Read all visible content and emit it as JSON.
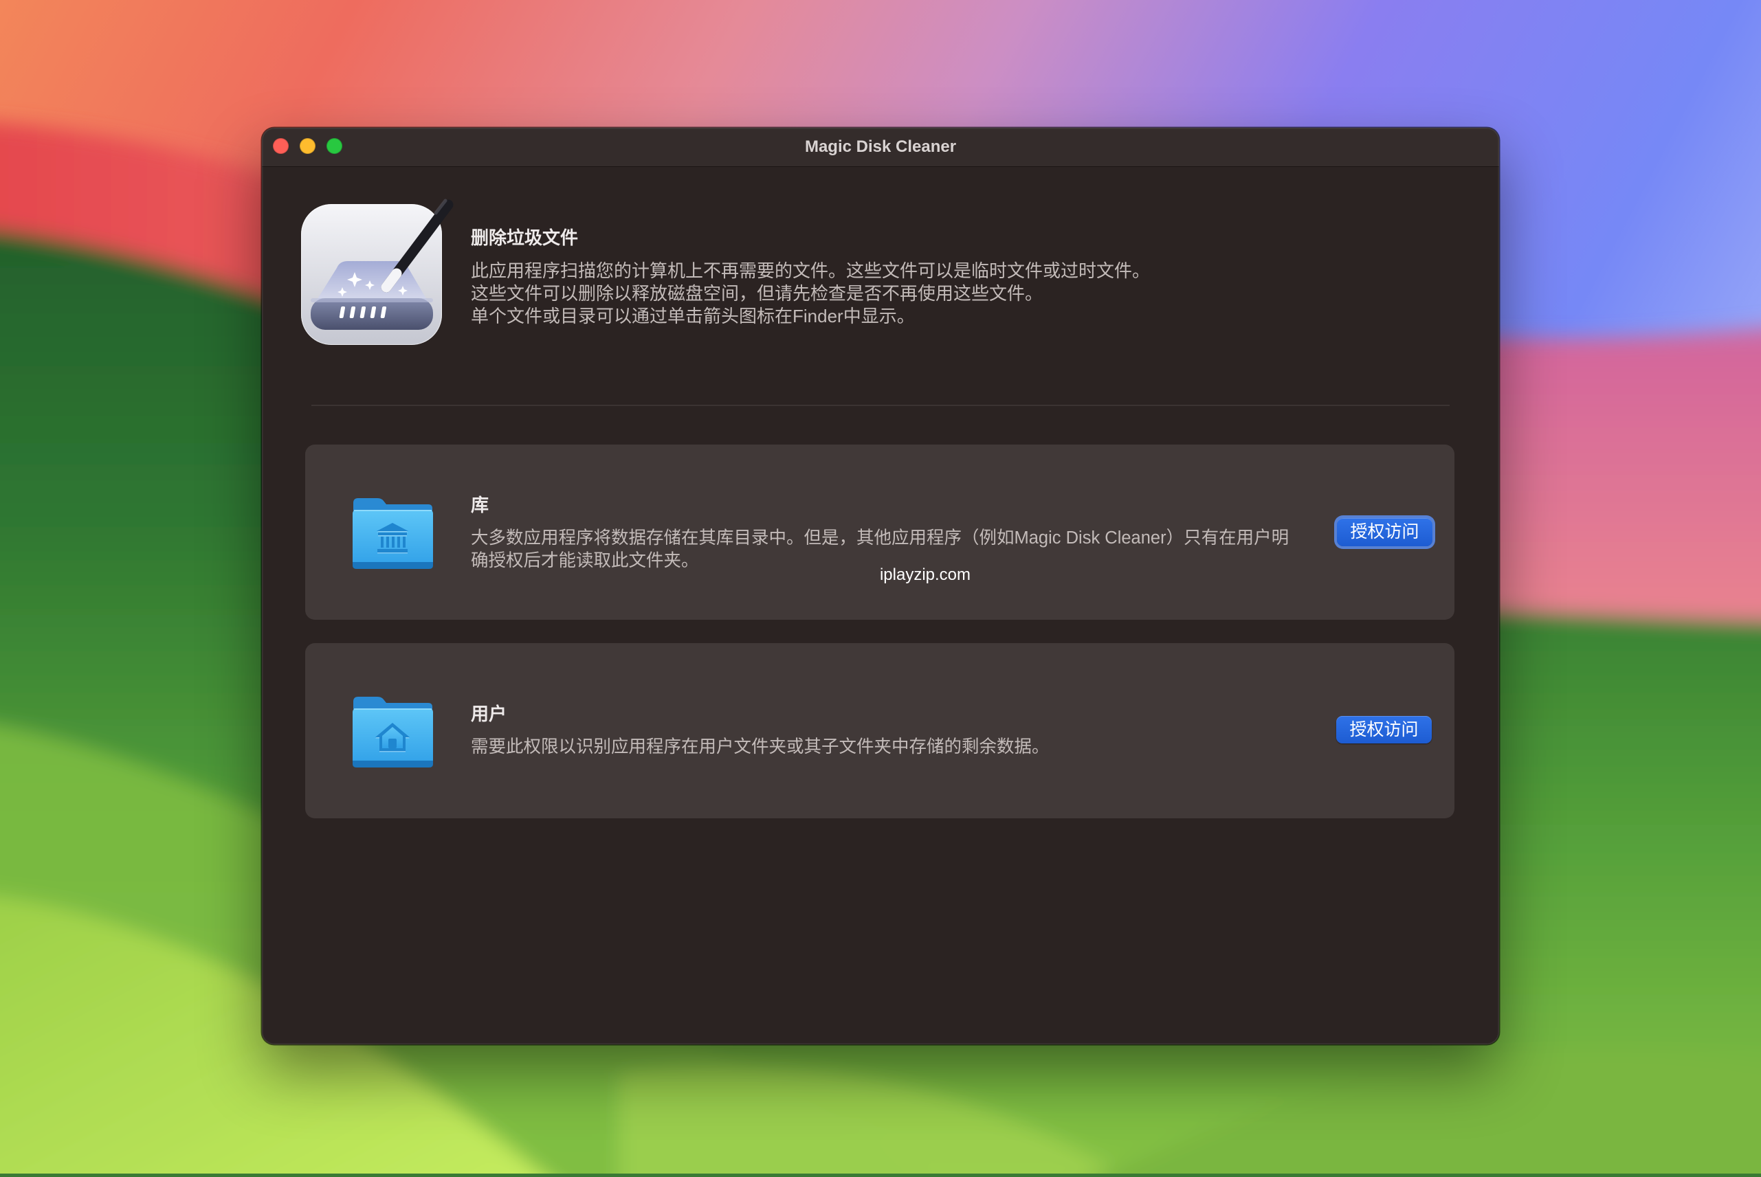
{
  "window": {
    "title": "Magic Disk Cleaner",
    "controls": [
      "close-icon",
      "minimize-icon",
      "zoom-icon"
    ]
  },
  "app_icon": "magic-disk-cleaner-app-icon",
  "header": {
    "title": "删除垃圾文件",
    "lines": [
      "此应用程序扫描您的计算机上不再需要的文件。这些文件可以是临时文件或过时文件。",
      "这些文件可以删除以释放磁盘空间，但请先检查是否不再使用这些文件。",
      "单个文件或目录可以通过单击箭头图标在Finder中显示。"
    ]
  },
  "sections": [
    {
      "icon": "library-folder-icon",
      "title": "库",
      "lines": [
        "大多数应用程序将数据存储在其库目录中。但是，其他应用程序（例如Magic Disk Cleaner）只有在用户明",
        "确授权后才能读取此文件夹。"
      ],
      "button": "授权访问",
      "focused": true
    },
    {
      "icon": "user-folder-icon",
      "title": "用户",
      "lines": [
        "需要此权限以识别应用程序在用户文件夹或其子文件夹中存储的剩余数据。"
      ],
      "button": "授权访问",
      "focused": false
    }
  ],
  "watermark": "iplayzip.com",
  "colors": {
    "accent": "#1d5cd2",
    "window_bg": "#2b2322",
    "card_bg": "#413938",
    "close": "#ff5f57",
    "minimize": "#febc2e",
    "zoom": "#28c840"
  }
}
